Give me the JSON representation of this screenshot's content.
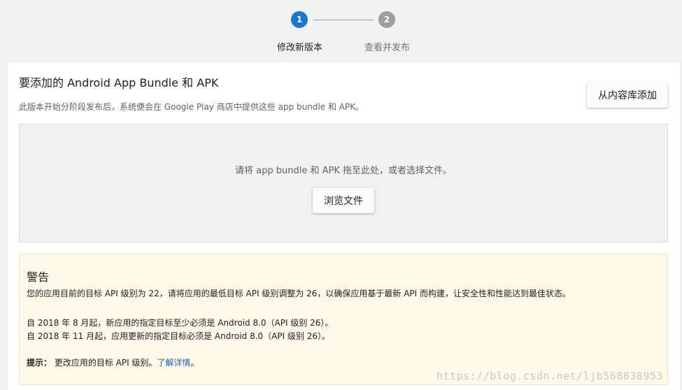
{
  "stepper": {
    "step1": {
      "number": "1",
      "label": "修改新版本"
    },
    "step2": {
      "number": "2",
      "label": "查看并发布"
    }
  },
  "upload_card": {
    "title": "要添加的 Android App Bundle 和 APK",
    "subtitle": "此版本开始分阶段发布后，系统便会在 Google Play 商店中提供这些 app bundle 和 APK。",
    "library_button": "从内容库添加",
    "dropzone_text": "请将 app bundle 和 APK 拖至此处，或者选择文件。",
    "browse_button": "浏览文件"
  },
  "warning": {
    "title": "警告",
    "line1": "您的应用目前的目标 API 级别为 22，请将应用的最低目标 API 级别调整为 26，以确保应用基于最新 API 而构建，让安全性和性能达到最佳状态。",
    "line2": "自 2018 年 8 月起，新应用的指定目标至少必须是 Android 8.0（API 级别 26）。",
    "line3": "自 2018 年 11 月起，应用更新的指定目标必须是 Android 8.0（API 级别 26）。",
    "tip_label": "提示：",
    "tip_text": "更改应用的目标 API 级别。",
    "tip_link": "了解详情",
    "tip_end": "。"
  },
  "watermark": "https://blog.csdn.net/ljb568838953",
  "colors": {
    "accent": "#1976d2",
    "inactive_step": "#9e9e9e",
    "warning_bg": "#fef9e9",
    "link": "#1565c0"
  }
}
